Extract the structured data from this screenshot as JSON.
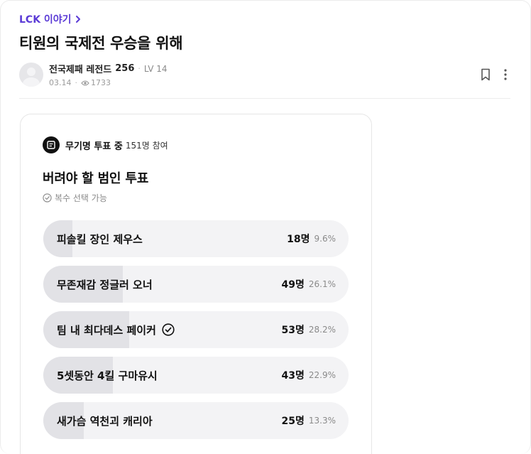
{
  "breadcrumb": {
    "label": "LCK 이야기"
  },
  "post": {
    "title": "티원의 국제전 우승을 위해",
    "author": {
      "nickname": "전국제패 레전드",
      "points": "256",
      "level": "LV 14"
    },
    "date": "03.14",
    "views": "1733"
  },
  "poll": {
    "status": "무기명 투표 중",
    "participants": "151명 참여",
    "question": "버려야 할 범인 투표",
    "multi_select": "복수 선택 가능",
    "options": [
      {
        "label": "피솔킬 장인 제우스",
        "count": "18명",
        "percent": "9.6%",
        "fraction": 0.096,
        "selected": false
      },
      {
        "label": "무존재감 정글러 오너",
        "count": "49명",
        "percent": "26.1%",
        "fraction": 0.261,
        "selected": false
      },
      {
        "label": "팀 내 최다데스 페이커",
        "count": "53명",
        "percent": "28.2%",
        "fraction": 0.282,
        "selected": true
      },
      {
        "label": "5셋동안 4킬 구마유시",
        "count": "43명",
        "percent": "22.9%",
        "fraction": 0.229,
        "selected": false
      },
      {
        "label": "새가슴 역천괴 캐리아",
        "count": "25명",
        "percent": "13.3%",
        "fraction": 0.133,
        "selected": false
      }
    ]
  },
  "icons": {
    "breadcrumb_chevron": "chevron-right-icon",
    "views": "eye-icon",
    "bookmark": "bookmark-icon",
    "more": "more-vertical-icon",
    "poll": "poll-icon",
    "multi": "check-circle-icon",
    "selected": "check-circle-icon"
  },
  "colors": {
    "accent": "#5b3bd6",
    "fill": "#e2e2e6",
    "track": "#f3f3f5"
  }
}
